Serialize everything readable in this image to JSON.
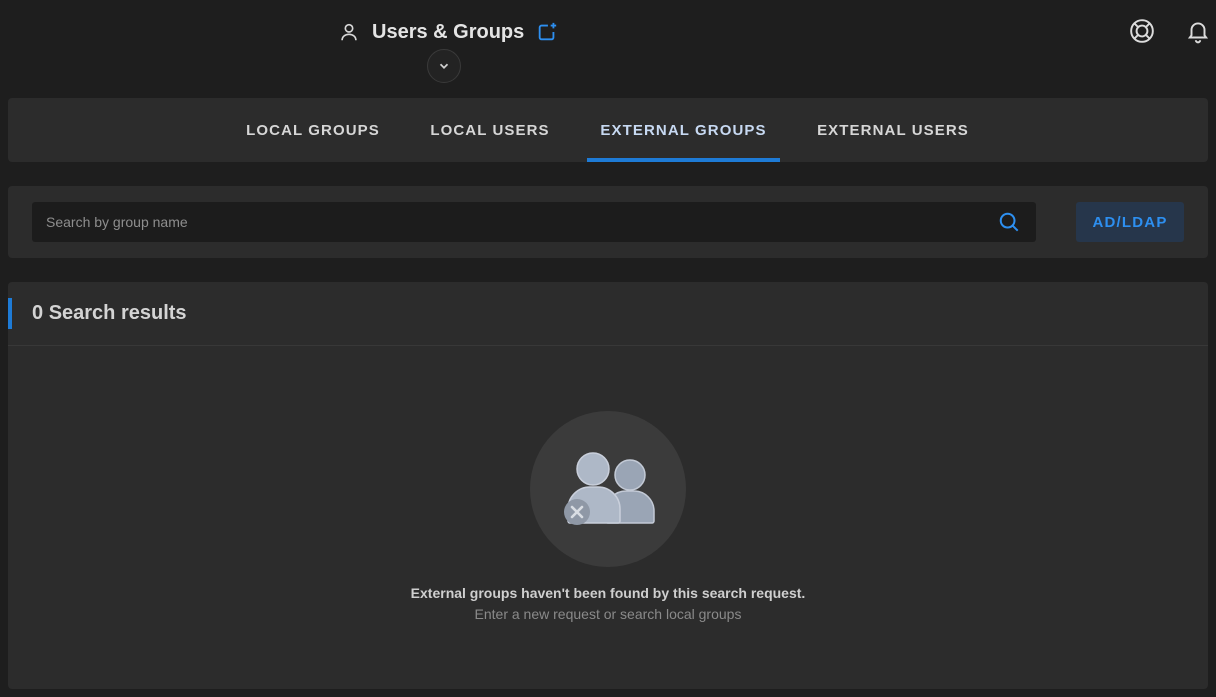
{
  "header": {
    "title": "Users & Groups",
    "icons": [
      "user-icon",
      "add-window-icon",
      "chevron-down-icon",
      "help-lifebuoy-icon",
      "bell-icon"
    ]
  },
  "tabs": [
    {
      "label": "LOCAL GROUPS",
      "active": false
    },
    {
      "label": "LOCAL USERS",
      "active": false
    },
    {
      "label": "EXTERNAL GROUPS",
      "active": true
    },
    {
      "label": "EXTERNAL USERS",
      "active": false
    }
  ],
  "search": {
    "placeholder": "Search by group name",
    "value": "",
    "button_label": "AD/LDAP"
  },
  "results": {
    "count": "0",
    "label": "Search results",
    "empty_title": "External groups haven't been found by this search request.",
    "empty_subtitle": "Enter a new request or search local groups"
  },
  "colors": {
    "accent": "#1e7bd6",
    "background": "#1e1e1e",
    "panel": "#2c2c2c"
  }
}
